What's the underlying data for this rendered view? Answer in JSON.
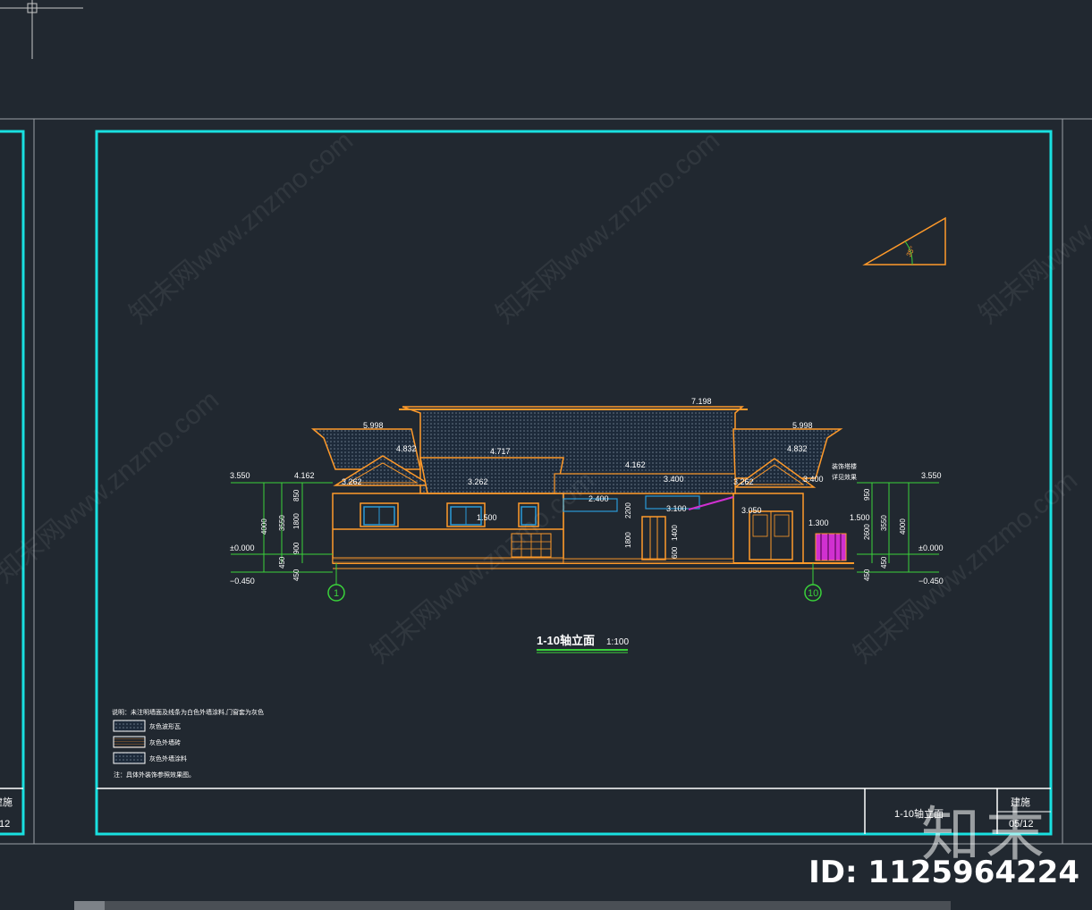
{
  "title": {
    "main": "1-10轴立面",
    "scale": "1:100"
  },
  "title_block": {
    "drawing_name": "1-10轴立面",
    "discipline": "建施",
    "sheet": "05/12",
    "left_discipline": "建施",
    "left_sheet": "/12"
  },
  "notes": {
    "header": "说明：未注明墙面及线条为白色外墙涂料,门窗套为灰色",
    "legend": [
      "灰色波形瓦",
      "灰色外墙砖",
      "灰色外墙涂料"
    ],
    "footnote": "注：具体外装饰参照效果图。"
  },
  "axes": {
    "left": "1",
    "right": "10"
  },
  "elevations": {
    "ridge_main": "7.198",
    "ridge_left": "5.998",
    "ridge_right": "5.998",
    "eave_left": "4.832",
    "eave_right": "4.832",
    "mid_roof": "4.717",
    "left_gable": "4.162",
    "right_mid": "4.162",
    "l_3262": "3.262",
    "c_3262": "3.262",
    "r_3262": "3.262",
    "c_3400": "3.400",
    "r_3400": "3.400",
    "l_3550": "3.550",
    "r_3550": "3.550",
    "c_2400": "2.400",
    "c_3100": "3.100",
    "r_3050": "3.050",
    "l_1500": "1.500",
    "r_1500": "1.500",
    "r_1300": "1.300",
    "l_zero": "±0.000",
    "r_zero": "±0.000",
    "l_neg": "−0.450",
    "r_neg": "−0.450"
  },
  "dimensions": {
    "left": [
      "4000",
      "3550",
      "850",
      "1800",
      "900",
      "450",
      "450"
    ],
    "right": [
      "950",
      "2600",
      "3550",
      "4000",
      "450",
      "450"
    ],
    "center": [
      "2200",
      "1800",
      "1400",
      "600"
    ]
  },
  "side_note": [
    "装饰塔楼",
    "详见效果"
  ],
  "roof_pitch": "35°",
  "watermark": "知末网www.znzmo.com",
  "id_label": "ID: 1125964224",
  "logo_text": "知末",
  "colors": {
    "background": "#212830",
    "frame_cyan": "#19e0e0",
    "building_orange": "#ff9a2a",
    "dimension_green": "#3ad23a",
    "roof_fill": "#1d2a3a",
    "glass_blue": "#2a9ad8",
    "accent_magenta": "#d030d0",
    "text_white": "#ffffff"
  }
}
